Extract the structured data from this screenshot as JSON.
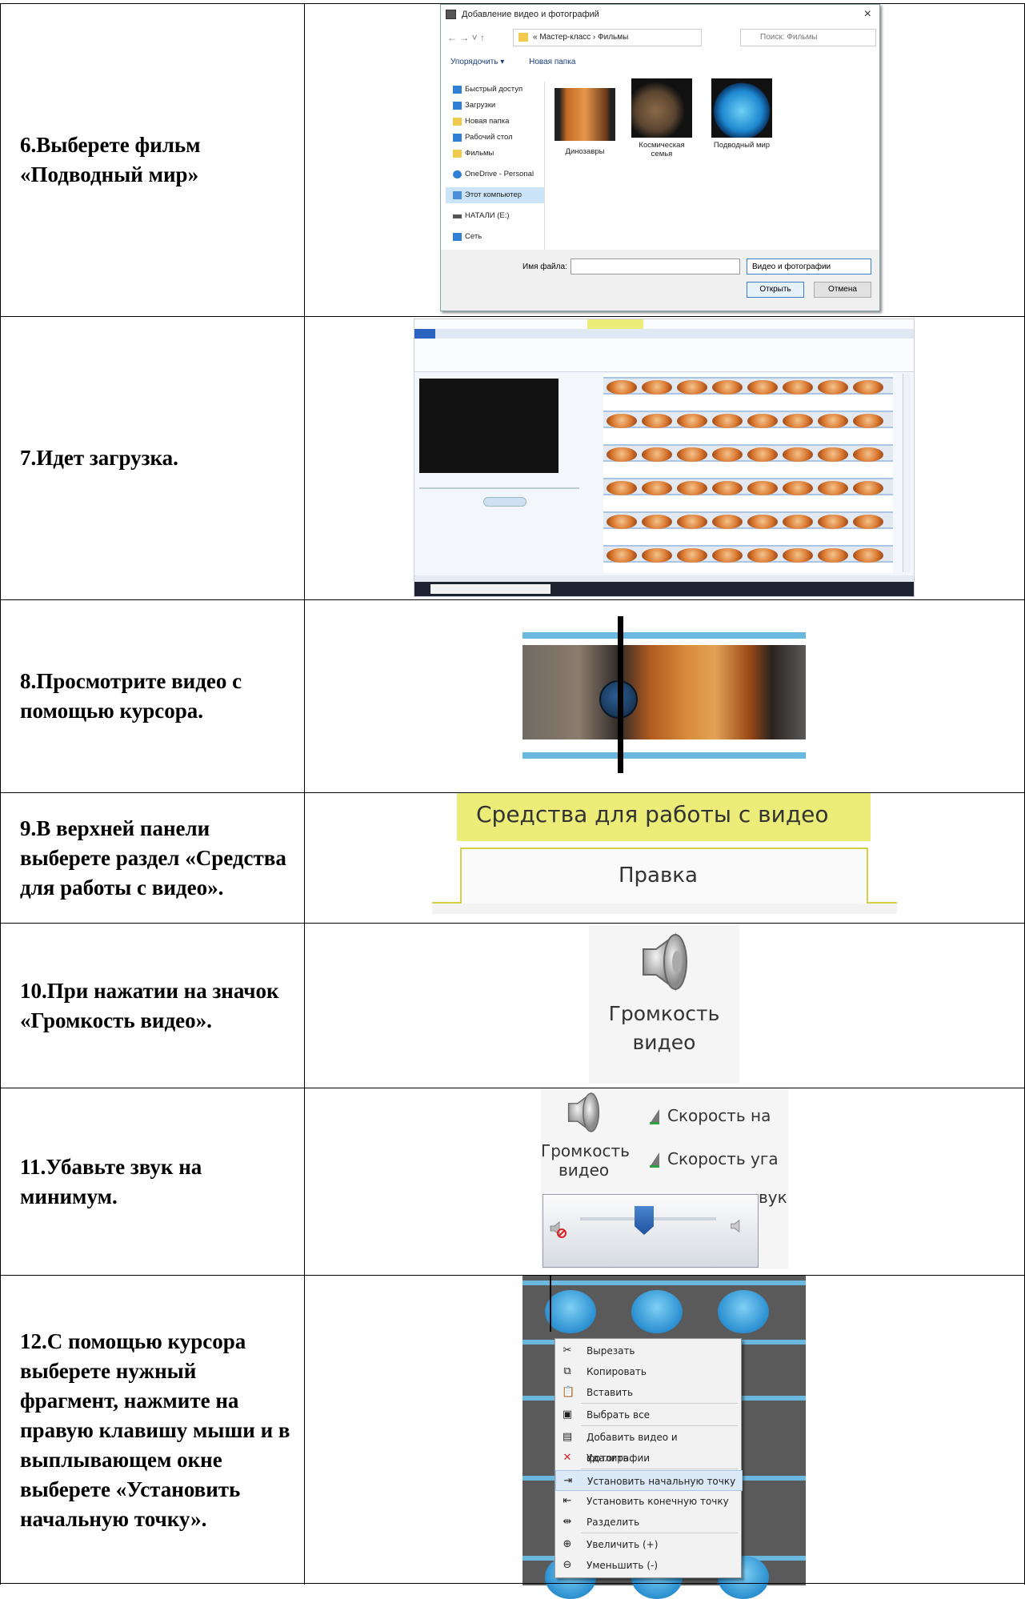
{
  "rows": [
    {
      "step": "6.Выберете фильм «Подводный мир»"
    },
    {
      "step": "7.Идет загрузка."
    },
    {
      "step": "8.Просмотрите видео с помощью курсора."
    },
    {
      "step": "9.В верхней панели выберете раздел «Средства для работы с видео»."
    },
    {
      "step": "10.При нажатии на значок «Громкость видео»."
    },
    {
      "step": "11.Убавьте звук на минимум."
    },
    {
      "step": "12.С помощью курсора выберете нужный фрагмент, нажмите на правую клавишу мыши и в выплывающем окне выберете «Установить начальную точку»."
    }
  ],
  "dialog": {
    "title": "Добавление видео и фотографий",
    "close": "×",
    "nav": "←  →  ˅  ↑",
    "path": "« Мастер-класс › Фильмы",
    "search_placeholder": "Поиск: Фильмы",
    "organize": "Упорядочить ▾",
    "new_folder": "Новая папка",
    "sidebar": [
      {
        "label": "Быстрый доступ",
        "color": "#2f7fd6"
      },
      {
        "label": "Загрузки",
        "color": "#2f7fd6"
      },
      {
        "label": "Новая папка",
        "color": "#f2c94c"
      },
      {
        "label": "Рабочий стол",
        "color": "#2f7fd6"
      },
      {
        "label": "Фильмы",
        "color": "#f2c94c"
      },
      {
        "label": "OneDrive - Personal",
        "color": "#2f7fd6"
      },
      {
        "label": "Этот компьютер",
        "color": "#4a90d9"
      },
      {
        "label": "НАТАЛИ (E:)",
        "color": "#555"
      },
      {
        "label": "Сеть",
        "color": "#2f7fd6"
      }
    ],
    "thumbs": [
      {
        "label": "Динозавры"
      },
      {
        "label": "Космическая семья"
      },
      {
        "label": "Подводный мир"
      }
    ],
    "filename_label": "Имя файла:",
    "filetype": "Видео и фотографии",
    "open_button": "Открыть",
    "cancel_button": "Отмена"
  },
  "ribbon": {
    "tools_label": "Средства для работы с видео",
    "edit_tab": "Правка"
  },
  "volume": {
    "label_line1": "Громкость",
    "label_line2": "видео",
    "speed1": "Скорость на",
    "speed2": "Скорость уга",
    "partial": "вук"
  },
  "context_menu": [
    {
      "label": "Вырезать",
      "icon": "scissors-icon",
      "glyph": "✂"
    },
    {
      "label": "Копировать",
      "icon": "copy-icon",
      "glyph": "⧉"
    },
    {
      "label": "Вставить",
      "icon": "paste-icon",
      "glyph": "📋"
    },
    {
      "label": "Выбрать все",
      "icon": "select-all-icon",
      "glyph": "▣"
    },
    {
      "label": "Добавить видео и фотографии",
      "icon": "add-media-icon",
      "glyph": "▤"
    },
    {
      "label": "Удалить",
      "icon": "delete-icon",
      "glyph": "✕"
    },
    {
      "label": "Установить начальную точку",
      "icon": "set-start-icon",
      "glyph": "⇥"
    },
    {
      "label": "Установить конечную точку",
      "icon": "set-end-icon",
      "glyph": "⇤"
    },
    {
      "label": "Разделить",
      "icon": "split-icon",
      "glyph": "⇹"
    },
    {
      "label": "Увеличить (+)",
      "icon": "zoom-in-icon",
      "glyph": "⊕"
    },
    {
      "label": "Уменьшить (-)",
      "icon": "zoom-out-icon",
      "glyph": "⊖"
    }
  ],
  "colors": {
    "tools_yellow": "#ecec78",
    "tab_border": "#d5cf46",
    "accent_blue": "#3b7ccb"
  }
}
